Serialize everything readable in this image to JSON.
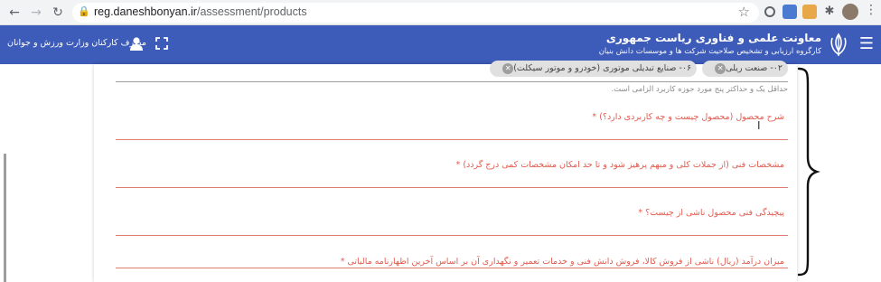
{
  "browser": {
    "url_host": "reg.daneshbonyan.ir",
    "url_path": "/assessment/products"
  },
  "header": {
    "title": "معاونت علمی و فناوری ریاست جمهوری",
    "subtitle": "کارگروه ارزیابی و تشخیص صلاحیت شرکت ها و موسسات دانش بنیان",
    "user_name": "مصرف کارکنان وزارت ورزش و جوانان"
  },
  "form": {
    "chips": [
      {
        "label": "۰۲- صنعت ریلی"
      },
      {
        "label": "۰۶- صنایع تبدیلی موتوری (خودرو و موتور سیکلت)"
      }
    ],
    "hint": "حداقل یک و حداکثر پنج مورد حوزه کاربرد الزامی است.",
    "fields": [
      {
        "label": "شرح محصول (محصول چیست و چه کاربردی دارد؟) *"
      },
      {
        "label": "مشخصات فنی (از جملات کلی و مبهم پرهیز شود و تا حد امکان مشخصات کمی درج گردد) *"
      },
      {
        "label": "پیچیدگی فنی محصول ناشی از چیست؟ *"
      },
      {
        "label": "میزان درآمد (ریال) ناشی از فروش کالا، فروش دانش فنی و خدمات تعمیر و نگهداری آن بر اساس آخرین اظهارنامه مالیاتی *"
      }
    ]
  },
  "colors": {
    "appbar": "#3d5bb8",
    "field_label": "#e15b4f",
    "field_line": "#e07d70"
  }
}
